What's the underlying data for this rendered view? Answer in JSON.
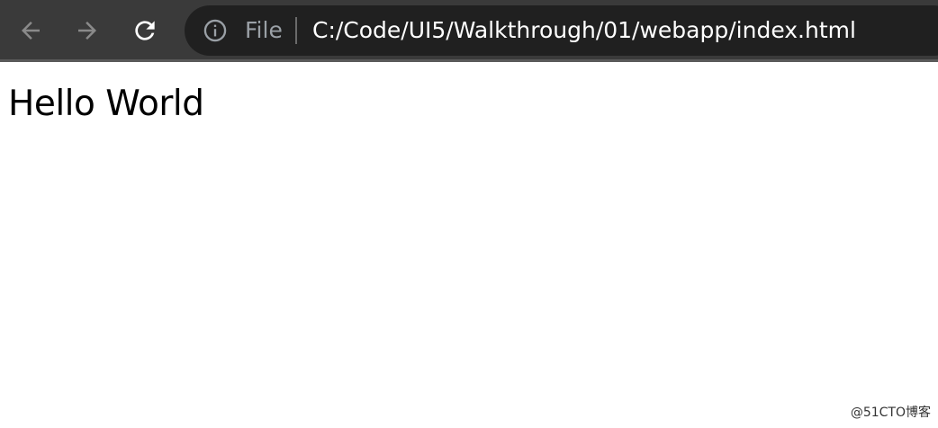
{
  "browser": {
    "nav": {
      "back_icon": "arrow-left-icon",
      "forward_icon": "arrow-right-icon",
      "reload_icon": "reload-icon"
    },
    "address_bar": {
      "info_icon": "info-icon",
      "scheme_label": "File",
      "url": "C:/Code/UI5/Walkthrough/01/webapp/index.html"
    }
  },
  "page": {
    "heading": "Hello World"
  },
  "watermark": {
    "text": "@51CTO博客"
  },
  "colors": {
    "toolbar_bg": "#3a3a3a",
    "omnibox_bg": "#202020",
    "url_text": "#ffffff",
    "scheme_text": "#9aa0a6",
    "page_bg": "#ffffff"
  }
}
